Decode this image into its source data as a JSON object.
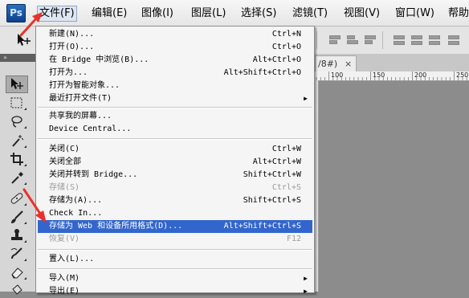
{
  "app": {
    "logo_text": "Ps"
  },
  "menubar": {
    "items": [
      {
        "label": "文件(F)"
      },
      {
        "label": "编辑(E)"
      },
      {
        "label": "图像(I)"
      },
      {
        "label": "图层(L)"
      },
      {
        "label": "选择(S)"
      },
      {
        "label": "滤镜(T)"
      },
      {
        "label": "视图(V)"
      },
      {
        "label": "窗口(W)"
      },
      {
        "label": "帮助"
      }
    ]
  },
  "document": {
    "tab_title": "/8#)",
    "close_glyph": "×",
    "ruler_labels": [
      "100",
      "150",
      "200",
      "250"
    ]
  },
  "toolbox": {
    "header_glyph": "»"
  },
  "file_menu": {
    "items": [
      {
        "label": "新建(N)...",
        "shortcut": "Ctrl+N"
      },
      {
        "label": "打开(O)...",
        "shortcut": "Ctrl+O"
      },
      {
        "label": "在 Bridge 中浏览(B)...",
        "shortcut": "Alt+Ctrl+O"
      },
      {
        "label": "打开为...",
        "shortcut": "Alt+Shift+Ctrl+O"
      },
      {
        "label": "打开为智能对象...",
        "shortcut": ""
      },
      {
        "label": "最近打开文件(T)",
        "shortcut": "",
        "submenu": true
      },
      {
        "label": "共享我的屏幕...",
        "shortcut": ""
      },
      {
        "label": "Device Central...",
        "shortcut": ""
      },
      {
        "label": "关闭(C)",
        "shortcut": "Ctrl+W"
      },
      {
        "label": "关闭全部",
        "shortcut": "Alt+Ctrl+W"
      },
      {
        "label": "关闭并转到 Bridge...",
        "shortcut": "Shift+Ctrl+W"
      },
      {
        "label": "存储(S)",
        "shortcut": "Ctrl+S",
        "disabled": true
      },
      {
        "label": "存储为(A)...",
        "shortcut": "Shift+Ctrl+S"
      },
      {
        "label": "Check In...",
        "shortcut": ""
      },
      {
        "label": "存储为 Web 和设备所用格式(D)...",
        "shortcut": "Alt+Shift+Ctrl+S",
        "highlighted": true
      },
      {
        "label": "恢复(V)",
        "shortcut": "F12",
        "disabled": true
      },
      {
        "label": "置入(L)...",
        "shortcut": ""
      },
      {
        "label": "导入(M)",
        "shortcut": "",
        "submenu": true
      },
      {
        "label": "导出(E)",
        "shortcut": "",
        "submenu": true
      }
    ],
    "submenu_glyph": "▶"
  },
  "colors": {
    "highlight": "#3366cc",
    "annotation_arrow": "#e8322b"
  }
}
